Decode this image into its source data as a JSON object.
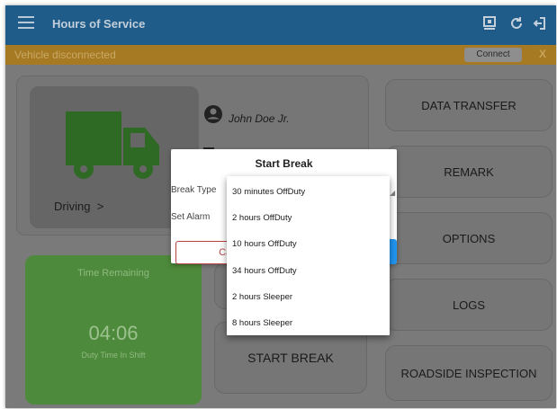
{
  "appbar": {
    "title": "Hours of Service",
    "icons": [
      "menu-icon",
      "eld-device-icon",
      "refresh-icon",
      "logout-icon"
    ]
  },
  "banner": {
    "message": "Vehicle disconnected",
    "connect_label": "Connect",
    "close_label": "X"
  },
  "status_card": {
    "status_label": "Driving",
    "chevron": ">",
    "driver_name": "John Doe Jr."
  },
  "time_card": {
    "heading": "Time Remaining",
    "value": "04:06",
    "caption": "Duty Time In Shift"
  },
  "actions": {
    "data_transfer": "DATA TRANSFER",
    "remark": "REMARK",
    "options": "OPTIONS",
    "logs": "LOGS",
    "roadside_inspection": "ROADSIDE INSPECTION",
    "start_break": "START BREAK"
  },
  "dialog": {
    "title": "Start Break",
    "break_type_label": "Break Type",
    "set_alarm_label": "Set Alarm",
    "cancel_label": "Car"
  },
  "dropdown": {
    "options": [
      "30 minutes OffDuty",
      "2 hours OffDuty",
      "10 hours OffDuty",
      "34 hours OffDuty",
      "2 hours Sleeper",
      "8 hours Sleeper"
    ]
  },
  "colors": {
    "appbar": "#1f5c8a",
    "banner": "#a67a23",
    "time_card": "#4e8a3b",
    "cancel_accent": "#b54545",
    "ok_accent": "#2196f3"
  }
}
